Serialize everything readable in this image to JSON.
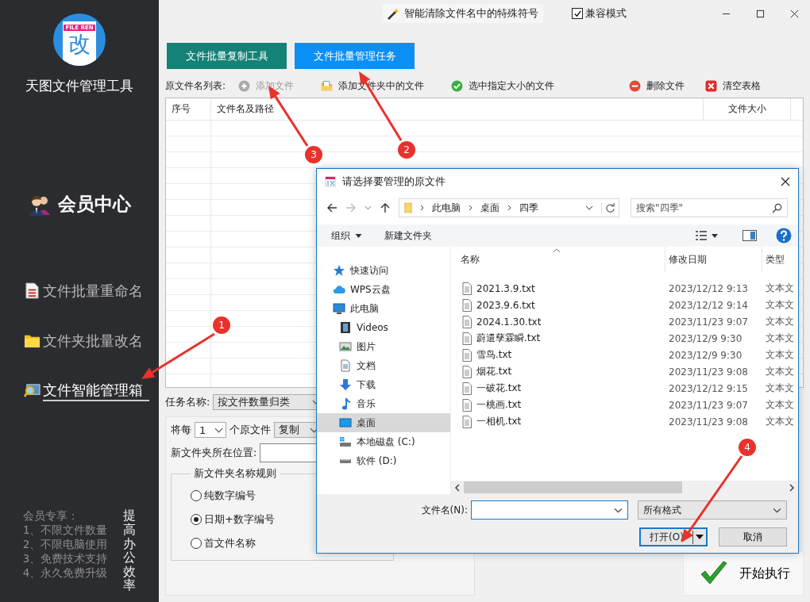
{
  "sidebar": {
    "logo": {
      "badge": "FILE REN",
      "glyph": "改"
    },
    "title": "天图文件管理工具",
    "member_center": "会员中心",
    "items": [
      {
        "label": "文件批量重命名",
        "kind": "document",
        "selected": false
      },
      {
        "label": "文件夹批量改名",
        "kind": "folder",
        "selected": false
      },
      {
        "label": "文件智能管理箱",
        "kind": "magnifier",
        "selected": true
      }
    ],
    "perks_title": "会员专享：",
    "perks": [
      "1、不限文件数量",
      "2、不限电脑使用",
      "3、免费技术支持",
      "4、永久免费升级"
    ],
    "slogan": "提高办公效率"
  },
  "titlebar": {
    "tip": "智能清除文件名中的特殊符号",
    "compat": {
      "label": "兼容模式",
      "checked": true
    }
  },
  "tabs": [
    {
      "label": "文件批量复制工具",
      "selected": false
    },
    {
      "label": "文件批量管理任务",
      "selected": true
    }
  ],
  "toolbar": {
    "label": "原文件名列表:",
    "actions": [
      {
        "label": "添加文件",
        "kind": "add",
        "disabled": true
      },
      {
        "label": "添加文件夹中的文件",
        "kind": "folder",
        "disabled": false
      },
      {
        "label": "选中指定大小的文件",
        "kind": "check",
        "disabled": false
      },
      {
        "label": "删除文件",
        "kind": "delete",
        "disabled": false
      },
      {
        "label": "清空表格",
        "kind": "clear",
        "disabled": false
      }
    ]
  },
  "table": {
    "columns": [
      "序号",
      "文件名及路径",
      "文件大小"
    ]
  },
  "task": {
    "label": "任务名称:",
    "value": "按文件数量归类"
  },
  "per_files": {
    "prefix": "将每",
    "count": "1",
    "middle": "个原文件",
    "action": "复制"
  },
  "location": {
    "label": "新文件夹所在位置:"
  },
  "naming": {
    "title": "新文件夹名称规则",
    "options": [
      {
        "label": "纯数字编号",
        "selected": false
      },
      {
        "label": "日期+数字编号",
        "selected": true
      },
      {
        "label": "首文件名称",
        "selected": false
      }
    ]
  },
  "run_button": "开始执行",
  "dialog": {
    "title": "请选择要管理的原文件",
    "breadcrumbs": [
      "此电脑",
      "桌面",
      "四季"
    ],
    "search": {
      "placeholder": "搜索\"四季\""
    },
    "toolbar": {
      "organize": "组织",
      "new_folder": "新建文件夹"
    },
    "nav": [
      {
        "label": "快速访问",
        "kind": "star",
        "selected": false
      },
      {
        "label": "WPS云盘",
        "kind": "cloud",
        "selected": false
      },
      {
        "label": "此电脑",
        "kind": "pc",
        "selected": false,
        "children": [
          {
            "label": "Videos",
            "kind": "video",
            "selected": false
          },
          {
            "label": "图片",
            "kind": "pictures",
            "selected": false
          },
          {
            "label": "文档",
            "kind": "docs",
            "selected": false
          },
          {
            "label": "下载",
            "kind": "download",
            "selected": false
          },
          {
            "label": "音乐",
            "kind": "music",
            "selected": false
          },
          {
            "label": "桌面",
            "kind": "desktop",
            "selected": true
          },
          {
            "label": "本地磁盘 (C:)",
            "kind": "system-drive",
            "selected": false
          },
          {
            "label": "软件 (D:)",
            "kind": "drive",
            "selected": false
          }
        ]
      }
    ],
    "columns": [
      "名称",
      "修改日期",
      "类型"
    ],
    "files": [
      {
        "name": "2021.3.9.txt",
        "date": "2023/12/12 9:13",
        "type": "文本文"
      },
      {
        "name": "2023.9.6.txt",
        "date": "2023/12/12 9:14",
        "type": "文本文"
      },
      {
        "name": "2024.1.30.txt",
        "date": "2023/11/23 9:07",
        "type": "文本文"
      },
      {
        "name": "蔚遣孳霖瞬.txt",
        "date": "2023/12/9 9:30",
        "type": "文本文"
      },
      {
        "name": "雪鸟.txt",
        "date": "2023/12/9 9:30",
        "type": "文本文"
      },
      {
        "name": "烟花.txt",
        "date": "2023/11/23 9:08",
        "type": "文本文"
      },
      {
        "name": "一破花.txt",
        "date": "2023/12/12 9:15",
        "type": "文本文"
      },
      {
        "name": "一桃画.txt",
        "date": "2023/11/23 9:07",
        "type": "文本文"
      },
      {
        "name": "一相机.txt",
        "date": "2023/11/23 9:08",
        "type": "文本文"
      }
    ],
    "filename_label": "文件名(N):",
    "filter": "所有格式",
    "open_button": "打开(O)",
    "cancel_button": "取消"
  },
  "annotations": [
    {
      "number": "1"
    },
    {
      "number": "2"
    },
    {
      "number": "3"
    },
    {
      "number": "4"
    }
  ]
}
